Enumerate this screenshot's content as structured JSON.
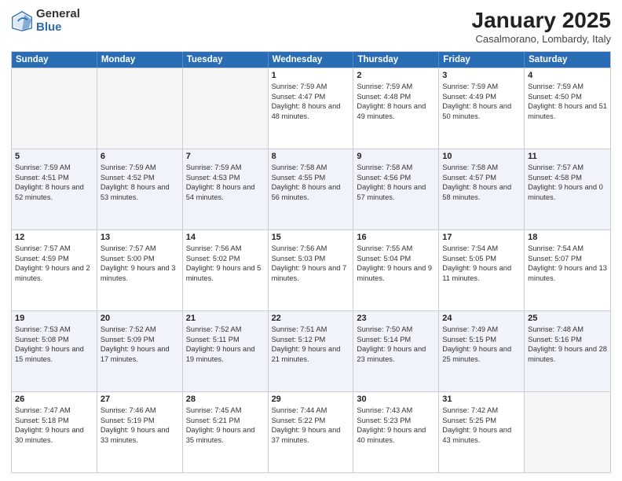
{
  "header": {
    "logo_general": "General",
    "logo_blue": "Blue",
    "month_title": "January 2025",
    "location": "Casalmorano, Lombardy, Italy"
  },
  "weekdays": [
    "Sunday",
    "Monday",
    "Tuesday",
    "Wednesday",
    "Thursday",
    "Friday",
    "Saturday"
  ],
  "rows": [
    {
      "cells": [
        {
          "day": "",
          "empty": true
        },
        {
          "day": "",
          "empty": true
        },
        {
          "day": "",
          "empty": true
        },
        {
          "day": "1",
          "sunrise": "7:59 AM",
          "sunset": "4:47 PM",
          "daylight": "8 hours and 48 minutes."
        },
        {
          "day": "2",
          "sunrise": "7:59 AM",
          "sunset": "4:48 PM",
          "daylight": "8 hours and 49 minutes."
        },
        {
          "day": "3",
          "sunrise": "7:59 AM",
          "sunset": "4:49 PM",
          "daylight": "8 hours and 50 minutes."
        },
        {
          "day": "4",
          "sunrise": "7:59 AM",
          "sunset": "4:50 PM",
          "daylight": "8 hours and 51 minutes."
        }
      ]
    },
    {
      "cells": [
        {
          "day": "5",
          "sunrise": "7:59 AM",
          "sunset": "4:51 PM",
          "daylight": "8 hours and 52 minutes."
        },
        {
          "day": "6",
          "sunrise": "7:59 AM",
          "sunset": "4:52 PM",
          "daylight": "8 hours and 53 minutes."
        },
        {
          "day": "7",
          "sunrise": "7:59 AM",
          "sunset": "4:53 PM",
          "daylight": "8 hours and 54 minutes."
        },
        {
          "day": "8",
          "sunrise": "7:58 AM",
          "sunset": "4:55 PM",
          "daylight": "8 hours and 56 minutes."
        },
        {
          "day": "9",
          "sunrise": "7:58 AM",
          "sunset": "4:56 PM",
          "daylight": "8 hours and 57 minutes."
        },
        {
          "day": "10",
          "sunrise": "7:58 AM",
          "sunset": "4:57 PM",
          "daylight": "8 hours and 58 minutes."
        },
        {
          "day": "11",
          "sunrise": "7:57 AM",
          "sunset": "4:58 PM",
          "daylight": "9 hours and 0 minutes."
        }
      ]
    },
    {
      "cells": [
        {
          "day": "12",
          "sunrise": "7:57 AM",
          "sunset": "4:59 PM",
          "daylight": "9 hours and 2 minutes."
        },
        {
          "day": "13",
          "sunrise": "7:57 AM",
          "sunset": "5:00 PM",
          "daylight": "9 hours and 3 minutes."
        },
        {
          "day": "14",
          "sunrise": "7:56 AM",
          "sunset": "5:02 PM",
          "daylight": "9 hours and 5 minutes."
        },
        {
          "day": "15",
          "sunrise": "7:56 AM",
          "sunset": "5:03 PM",
          "daylight": "9 hours and 7 minutes."
        },
        {
          "day": "16",
          "sunrise": "7:55 AM",
          "sunset": "5:04 PM",
          "daylight": "9 hours and 9 minutes."
        },
        {
          "day": "17",
          "sunrise": "7:54 AM",
          "sunset": "5:05 PM",
          "daylight": "9 hours and 11 minutes."
        },
        {
          "day": "18",
          "sunrise": "7:54 AM",
          "sunset": "5:07 PM",
          "daylight": "9 hours and 13 minutes."
        }
      ]
    },
    {
      "cells": [
        {
          "day": "19",
          "sunrise": "7:53 AM",
          "sunset": "5:08 PM",
          "daylight": "9 hours and 15 minutes."
        },
        {
          "day": "20",
          "sunrise": "7:52 AM",
          "sunset": "5:09 PM",
          "daylight": "9 hours and 17 minutes."
        },
        {
          "day": "21",
          "sunrise": "7:52 AM",
          "sunset": "5:11 PM",
          "daylight": "9 hours and 19 minutes."
        },
        {
          "day": "22",
          "sunrise": "7:51 AM",
          "sunset": "5:12 PM",
          "daylight": "9 hours and 21 minutes."
        },
        {
          "day": "23",
          "sunrise": "7:50 AM",
          "sunset": "5:14 PM",
          "daylight": "9 hours and 23 minutes."
        },
        {
          "day": "24",
          "sunrise": "7:49 AM",
          "sunset": "5:15 PM",
          "daylight": "9 hours and 25 minutes."
        },
        {
          "day": "25",
          "sunrise": "7:48 AM",
          "sunset": "5:16 PM",
          "daylight": "9 hours and 28 minutes."
        }
      ]
    },
    {
      "cells": [
        {
          "day": "26",
          "sunrise": "7:47 AM",
          "sunset": "5:18 PM",
          "daylight": "9 hours and 30 minutes."
        },
        {
          "day": "27",
          "sunrise": "7:46 AM",
          "sunset": "5:19 PM",
          "daylight": "9 hours and 33 minutes."
        },
        {
          "day": "28",
          "sunrise": "7:45 AM",
          "sunset": "5:21 PM",
          "daylight": "9 hours and 35 minutes."
        },
        {
          "day": "29",
          "sunrise": "7:44 AM",
          "sunset": "5:22 PM",
          "daylight": "9 hours and 37 minutes."
        },
        {
          "day": "30",
          "sunrise": "7:43 AM",
          "sunset": "5:23 PM",
          "daylight": "9 hours and 40 minutes."
        },
        {
          "day": "31",
          "sunrise": "7:42 AM",
          "sunset": "5:25 PM",
          "daylight": "9 hours and 43 minutes."
        },
        {
          "day": "",
          "empty": true
        }
      ]
    }
  ]
}
